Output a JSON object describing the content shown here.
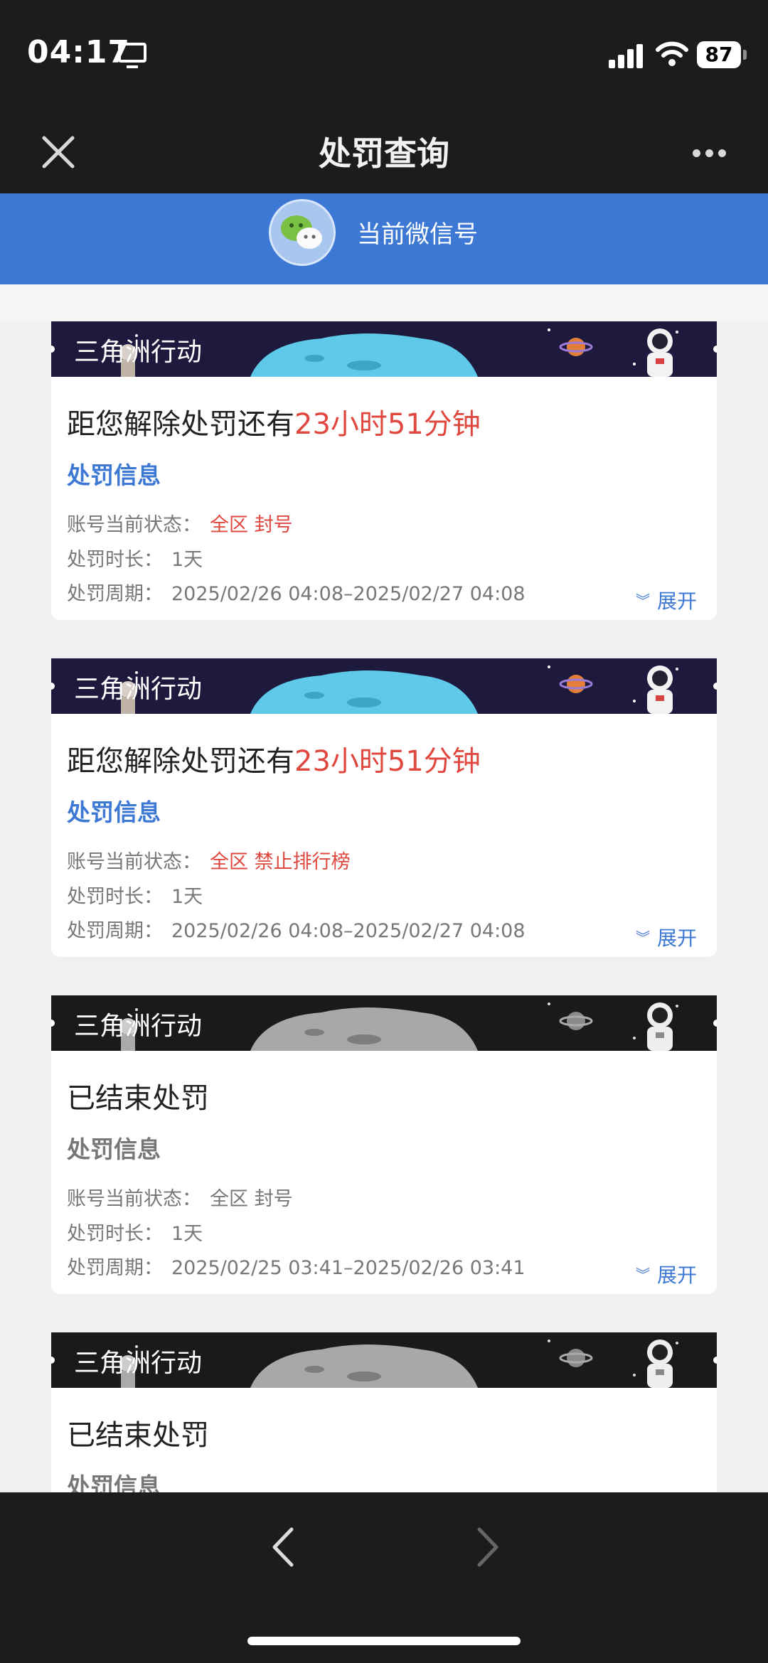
{
  "status_bar": {
    "time": "04:17",
    "battery": "87"
  },
  "nav": {
    "title": "处罚查询"
  },
  "account": {
    "label": "当前微信号"
  },
  "cards": [
    {
      "banner_title": "三角洲行动",
      "headline_prefix": "距您解除处罚还有",
      "headline_highlight": "23小时51分钟",
      "section_title": "处罚信息",
      "status_label": "账号当前状态：",
      "status_value": "全区 封号",
      "duration_label": "处罚时长：",
      "duration_value": "1天",
      "period_label": "处罚周期：",
      "period_value": "2025/02/26 04:08–2025/02/27 04:08",
      "expand_label": "展开"
    },
    {
      "banner_title": "三角洲行动",
      "headline_prefix": "距您解除处罚还有",
      "headline_highlight": "23小时51分钟",
      "section_title": "处罚信息",
      "status_label": "账号当前状态：",
      "status_value": "全区 禁止排行榜",
      "duration_label": "处罚时长：",
      "duration_value": "1天",
      "period_label": "处罚周期：",
      "period_value": "2025/02/26 04:08–2025/02/27 04:08",
      "expand_label": "展开"
    },
    {
      "banner_title": "三角洲行动",
      "headline_prefix": "已结束处罚",
      "headline_highlight": "",
      "section_title": "处罚信息",
      "status_label": "账号当前状态：",
      "status_value": "全区 封号",
      "duration_label": "处罚时长：",
      "duration_value": "1天",
      "period_label": "处罚周期：",
      "period_value": "2025/02/25 03:41–2025/02/26 03:41",
      "expand_label": "展开"
    },
    {
      "banner_title": "三角洲行动",
      "headline_prefix": "已结束处罚",
      "headline_highlight": "",
      "section_title": "处罚信息"
    }
  ],
  "colors": {
    "accent_blue": "#3c78d4",
    "alert_red": "#e0473f",
    "active_banner_bg": "#1d1a3e",
    "ended_banner_bg": "#1a1a1a"
  },
  "icons": [
    "screen-mirror-icon",
    "cellular-signal-icon",
    "wifi-icon",
    "battery-icon",
    "close-icon",
    "more-icon",
    "wechat-icon",
    "astronaut-icon",
    "planet-icon",
    "moon-icon",
    "chevron-down-double-icon",
    "back-arrow-icon",
    "forward-arrow-icon"
  ]
}
